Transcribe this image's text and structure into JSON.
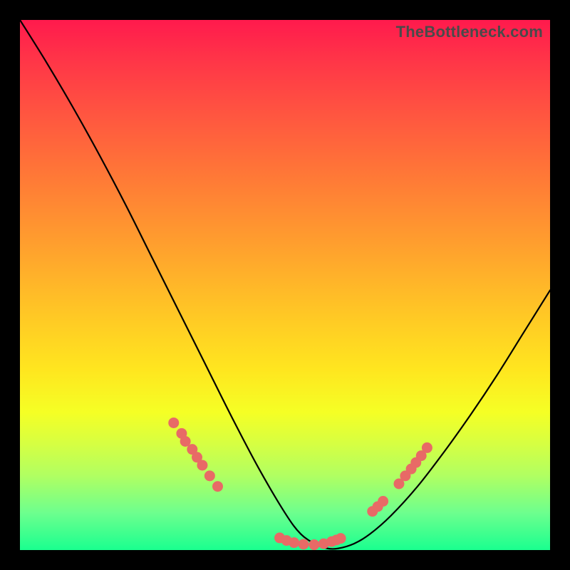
{
  "watermark": "TheBottleneck.com",
  "colors": {
    "background": "#000000",
    "curve": "#000000",
    "dotFill": "#e86a66",
    "dotFillAlt": "#e98a7a",
    "gradientTop": "#ff1a4d",
    "gradientBottom": "#1aff8f"
  },
  "chart_data": {
    "type": "line",
    "title": "",
    "xlabel": "",
    "ylabel": "",
    "xlim": [
      0,
      100
    ],
    "ylim": [
      0,
      100
    ],
    "grid": false,
    "series": [
      {
        "name": "bottleneck-curve",
        "x": [
          0,
          5,
          10,
          15,
          20,
          25,
          30,
          35,
          40,
          45,
          50,
          53,
          56,
          58,
          60,
          63,
          66,
          70,
          75,
          80,
          85,
          90,
          95,
          100
        ],
        "y": [
          100,
          92,
          83.5,
          74.5,
          65,
          55,
          45,
          35,
          25,
          15.5,
          7,
          3,
          1,
          0.3,
          0.3,
          1.2,
          3,
          6.5,
          12,
          18.5,
          25.5,
          33,
          41,
          49
        ]
      }
    ],
    "highlight_clusters": [
      {
        "name": "left-slope-dots",
        "points": [
          {
            "x": 29.0,
            "y": 24.0
          },
          {
            "x": 30.5,
            "y": 22.0
          },
          {
            "x": 31.2,
            "y": 20.5
          },
          {
            "x": 32.5,
            "y": 19.0
          },
          {
            "x": 33.4,
            "y": 17.5
          },
          {
            "x": 34.4,
            "y": 16.0
          },
          {
            "x": 35.8,
            "y": 14.0
          },
          {
            "x": 37.3,
            "y": 12.0
          }
        ]
      },
      {
        "name": "valley-dots",
        "points": [
          {
            "x": 49.0,
            "y": 2.3
          },
          {
            "x": 50.3,
            "y": 1.8
          },
          {
            "x": 51.7,
            "y": 1.4
          },
          {
            "x": 53.5,
            "y": 1.1
          },
          {
            "x": 55.5,
            "y": 1.0
          },
          {
            "x": 57.3,
            "y": 1.2
          },
          {
            "x": 58.8,
            "y": 1.6
          },
          {
            "x": 59.7,
            "y": 1.9
          },
          {
            "x": 60.5,
            "y": 2.2
          }
        ]
      },
      {
        "name": "right-slope-dots",
        "points": [
          {
            "x": 66.5,
            "y": 7.3
          },
          {
            "x": 67.5,
            "y": 8.2
          },
          {
            "x": 68.5,
            "y": 9.2
          },
          {
            "x": 71.5,
            "y": 12.5
          },
          {
            "x": 72.7,
            "y": 14.0
          },
          {
            "x": 73.8,
            "y": 15.3
          },
          {
            "x": 74.7,
            "y": 16.5
          },
          {
            "x": 75.7,
            "y": 17.8
          },
          {
            "x": 76.8,
            "y": 19.3
          }
        ]
      }
    ]
  }
}
